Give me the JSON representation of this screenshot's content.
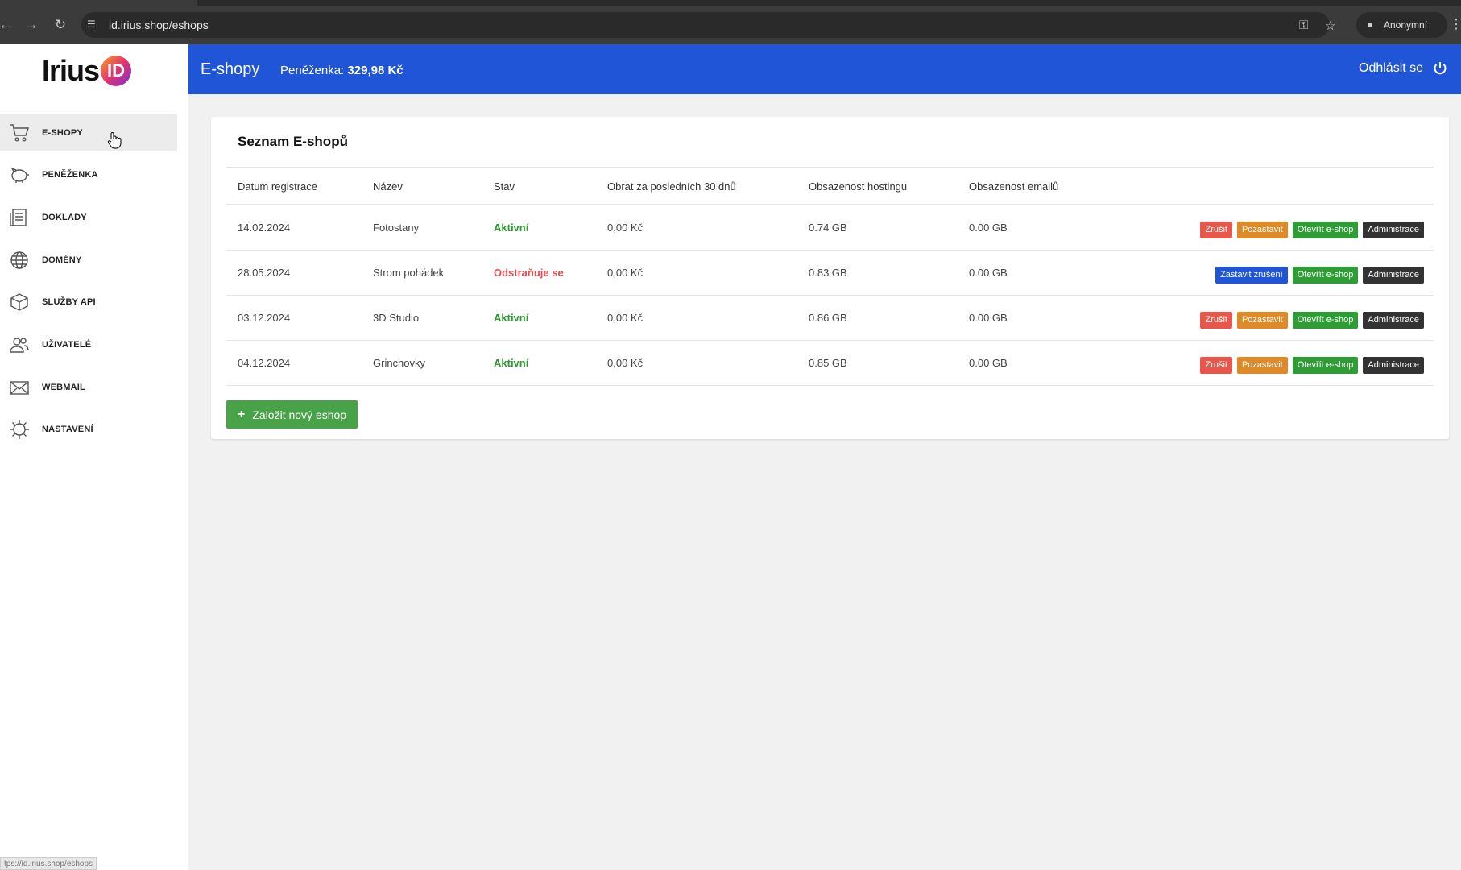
{
  "browser": {
    "url": "id.irius.shop/eshops",
    "profile_label": "Anonymní"
  },
  "logo": {
    "text": "Irius",
    "badge": "ID"
  },
  "sidebar": {
    "items": [
      {
        "label": "E-SHOPY",
        "icon": "cart-icon",
        "active": true
      },
      {
        "label": "PENĚŽENKA",
        "icon": "piggy-bank-icon"
      },
      {
        "label": "DOKLADY",
        "icon": "document-icon"
      },
      {
        "label": "DOMÉNY",
        "icon": "globe-icon"
      },
      {
        "label": "SLUŽBY API",
        "icon": "cube-icon"
      },
      {
        "label": "UŽIVATELÉ",
        "icon": "users-icon"
      },
      {
        "label": "WEBMAIL",
        "icon": "envelope-icon"
      },
      {
        "label": "NASTAVENÍ",
        "icon": "gear-icon"
      }
    ]
  },
  "header": {
    "title": "E-shopy",
    "wallet_label": "Peněženka: ",
    "wallet_value": "329,98 Kč",
    "logout_label": "Odhlásit se",
    "color": "#1f55d6"
  },
  "card": {
    "title": "Seznam E-shopů",
    "columns": [
      "Datum registrace",
      "Název",
      "Stav",
      "Obrat za posledních 30 dnů",
      "Obsazenost hostingu",
      "Obsazenost emailů"
    ],
    "rows": [
      {
        "date": "14.02.2024",
        "name": "Fotostany",
        "status": "Aktivní",
        "turnover": "0,00 Kč",
        "hosting": "0.74 GB",
        "email": "0.00 GB"
      },
      {
        "date": "28.05.2024",
        "name": "Strom pohádek",
        "status": "Odstraňuje se",
        "turnover": "0,00 Kč",
        "hosting": "0.83 GB",
        "email": "0.00 GB"
      },
      {
        "date": "03.12.2024",
        "name": "3D Studio",
        "status": "Aktivní",
        "turnover": "0,00 Kč",
        "hosting": "0.86 GB",
        "email": "0.00 GB"
      },
      {
        "date": "04.12.2024",
        "name": "Grinchovky",
        "status": "Aktivní",
        "turnover": "0,00 Kč",
        "hosting": "0.85 GB",
        "email": "0.00 GB"
      }
    ],
    "actions": {
      "cancel": "Zrušit",
      "pause": "Pozastavit",
      "open": "Otevřít e-shop",
      "admin": "Administrace",
      "stop_cancel": "Zastavit zrušení"
    },
    "new_button": "Založit nový eshop"
  },
  "status_bar_url": "tps://id.irius.shop/eshops"
}
